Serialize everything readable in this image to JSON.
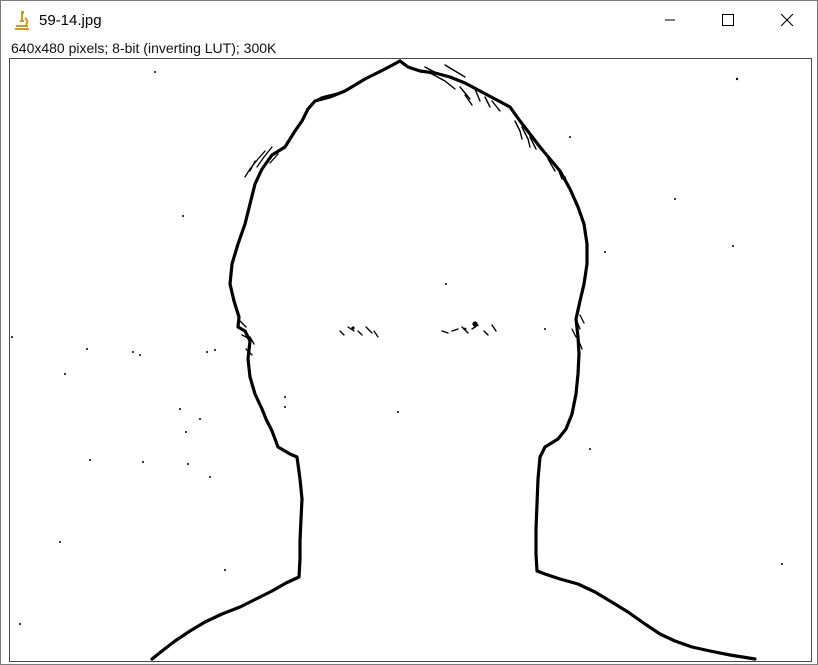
{
  "window": {
    "title": "59-14.jpg",
    "app_icon": "microscope-icon",
    "controls": {
      "minimize_icon": "minimize-icon",
      "maximize_icon": "maximize-icon",
      "close_icon": "close-icon"
    }
  },
  "image_info": "640x480 pixels; 8-bit (inverting LUT); 300K",
  "colors": {
    "app_icon": "#d19a1e",
    "edge_stroke": "#000000",
    "background": "#ffffff"
  }
}
